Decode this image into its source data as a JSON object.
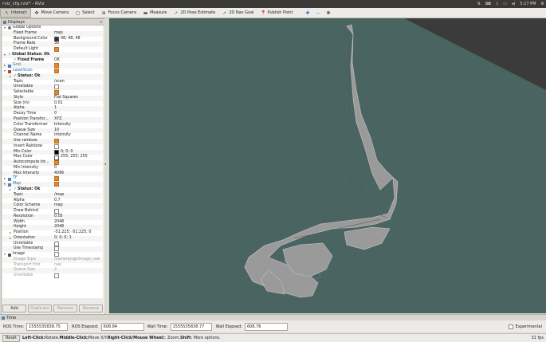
{
  "window": {
    "title": "rviz_cfg.rviz* - RViz",
    "clock": "5:17 PM"
  },
  "toolbar": [
    {
      "label": "Interact",
      "icon": "cursor-icon",
      "active": true
    },
    {
      "label": "Move Camera",
      "icon": "camera-icon"
    },
    {
      "label": "Select",
      "icon": "select-icon"
    },
    {
      "label": "Focus Camera",
      "icon": "focus-icon"
    },
    {
      "label": "Measure",
      "icon": "ruler-icon"
    },
    {
      "label": "2D Pose Estimate",
      "icon": "pose-arrow-icon"
    },
    {
      "label": "2D Nav Goal",
      "icon": "goal-arrow-icon"
    },
    {
      "label": "Publish Point",
      "icon": "pin-icon"
    }
  ],
  "displays": {
    "title": "Displays",
    "rows": [
      {
        "d": 0,
        "exp": "down",
        "label": "Global Options",
        "icon": "gear-icon"
      },
      {
        "d": 1,
        "label": "Fixed Frame",
        "value": "map"
      },
      {
        "d": 1,
        "label": "Background Color",
        "value": "48; 48; 48",
        "swatch": "#303030"
      },
      {
        "d": 1,
        "label": "Frame Rate",
        "value": "30"
      },
      {
        "d": 1,
        "label": "Default Light",
        "check": true
      },
      {
        "d": 0,
        "exp": "down",
        "label": "Global Status: Ok",
        "ok": true
      },
      {
        "d": 1,
        "label": "Fixed Frame",
        "value": "OK",
        "ok": true
      },
      {
        "d": 0,
        "exp": "right",
        "label": "Grid",
        "blue": true,
        "icon": "grid-icon",
        "check": true
      },
      {
        "d": 0,
        "exp": "down",
        "label": "LaserScan",
        "blue": true,
        "icon": "laserscan-icon",
        "check": true
      },
      {
        "d": 1,
        "exp": "right",
        "label": "Status: Ok",
        "ok": true
      },
      {
        "d": 1,
        "label": "Topic",
        "value": "/scan"
      },
      {
        "d": 1,
        "label": "Unreliable",
        "check": false
      },
      {
        "d": 1,
        "label": "Selectable",
        "check": true
      },
      {
        "d": 1,
        "label": "Style",
        "value": "Flat Squares"
      },
      {
        "d": 1,
        "label": "Size (m)",
        "value": "0.01"
      },
      {
        "d": 1,
        "label": "Alpha",
        "value": "1"
      },
      {
        "d": 1,
        "label": "Decay Time",
        "value": "0"
      },
      {
        "d": 1,
        "label": "Position Transfor...",
        "value": "XYZ"
      },
      {
        "d": 1,
        "label": "Color Transformer",
        "value": "Intensity"
      },
      {
        "d": 1,
        "label": "Queue Size",
        "value": "10"
      },
      {
        "d": 1,
        "label": "Channel Name",
        "value": "intensity"
      },
      {
        "d": 1,
        "label": "Use rainbow",
        "check": true
      },
      {
        "d": 1,
        "label": "Invert Rainbow",
        "check": false
      },
      {
        "d": 1,
        "label": "Min Color",
        "value": "0; 0; 0",
        "swatch": "#000000"
      },
      {
        "d": 1,
        "label": "Max Color",
        "value": "255; 255; 255",
        "swatch": "#ffffff"
      },
      {
        "d": 1,
        "label": "Autocompute Int...",
        "check": true
      },
      {
        "d": 1,
        "label": "Min Intensity",
        "value": "0"
      },
      {
        "d": 1,
        "label": "Max Intensity",
        "value": "4096"
      },
      {
        "d": 0,
        "exp": "right",
        "label": "TF",
        "blue": true,
        "icon": "tf-icon",
        "check": true
      },
      {
        "d": 0,
        "exp": "down",
        "label": "Map",
        "blue": true,
        "icon": "map-icon",
        "check": true
      },
      {
        "d": 1,
        "exp": "right",
        "label": "Status: Ok",
        "ok": true
      },
      {
        "d": 1,
        "label": "Topic",
        "value": "/map"
      },
      {
        "d": 1,
        "label": "Alpha",
        "value": "0.7"
      },
      {
        "d": 1,
        "label": "Color Scheme",
        "value": "map"
      },
      {
        "d": 1,
        "label": "Draw Behind",
        "check": false
      },
      {
        "d": 1,
        "label": "Resolution",
        "value": "0.05"
      },
      {
        "d": 1,
        "label": "Width",
        "value": "2048"
      },
      {
        "d": 1,
        "label": "Height",
        "value": "2048"
      },
      {
        "d": 1,
        "exp": "right",
        "label": "Position",
        "value": "-51.225; -51.225; 0"
      },
      {
        "d": 1,
        "exp": "right",
        "label": "Orientation",
        "value": "0; 0; 0; 1"
      },
      {
        "d": 1,
        "label": "Unreliable",
        "check": false
      },
      {
        "d": 1,
        "label": "Use Timestamp",
        "check": false
      },
      {
        "d": 0,
        "exp": "down",
        "label": "Image",
        "icon": "image-icon",
        "check": false
      },
      {
        "d": 1,
        "label": "Image Topic",
        "value": "/camera/rgb/image_raw",
        "grey": true
      },
      {
        "d": 1,
        "label": "Transport Hint",
        "value": "raw",
        "grey": true
      },
      {
        "d": 1,
        "label": "Queue Size",
        "value": "2",
        "grey": true
      },
      {
        "d": 1,
        "label": "Unreliable",
        "check": false,
        "grey": true
      }
    ],
    "buttons": [
      {
        "label": "Add",
        "enabled": true
      },
      {
        "label": "Duplicate",
        "enabled": false
      },
      {
        "label": "Remove",
        "enabled": false
      },
      {
        "label": "Rename",
        "enabled": false
      }
    ]
  },
  "time": {
    "title": "Time",
    "ros_time_label": "ROS Time:",
    "ros_time": "1555535838.75",
    "ros_elapsed_label": "ROS Elapsed:",
    "ros_elapsed": "608.84",
    "wall_time_label": "Wall Time:",
    "wall_time": "1555535838.77",
    "wall_elapsed_label": "Wall Elapsed:",
    "wall_elapsed": "608.76",
    "experimental_label": "Experimental"
  },
  "status": {
    "reset": "Reset",
    "hint_bold1": "Left-Click:",
    "hint1": " Rotate. ",
    "hint_bold2": "Middle-Click:",
    "hint2": " Move X/Y. ",
    "hint_bold3": "Right-Click/Mouse Wheel:",
    "hint3": ": Zoom. ",
    "hint_bold4": "Shift",
    "hint4": ": More options.",
    "fps": "31 fps"
  }
}
